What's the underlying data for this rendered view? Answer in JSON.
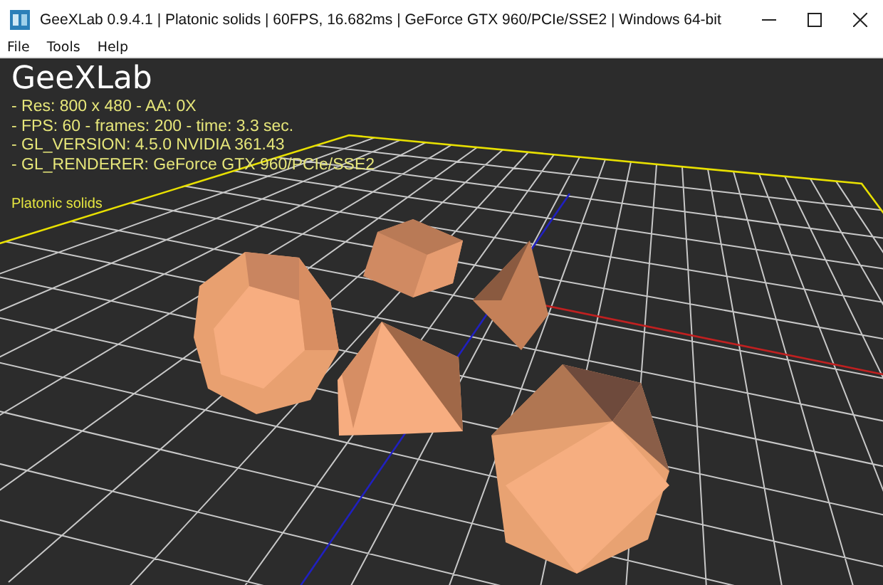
{
  "window": {
    "title": "GeeXLab 0.9.4.1 | Platonic solids | 60FPS, 16.682ms | GeForce GTX 960/PCIe/SSE2 | Windows 64-bit"
  },
  "menu": [
    {
      "label": "File"
    },
    {
      "label": "Tools"
    },
    {
      "label": "Help"
    }
  ],
  "overlay": {
    "title": "GeeXLab",
    "info_lines": [
      "- Res: 800 x 480 - AA: 0X",
      "- FPS: 60 - frames: 200 - time: 3.3 sec.",
      "- GL_VERSION: 4.5.0 NVIDIA 361.43",
      "- GL_RENDERER: GeForce GTX 960/PCIe/SSE2"
    ],
    "scene_label": "Platonic solids"
  }
}
